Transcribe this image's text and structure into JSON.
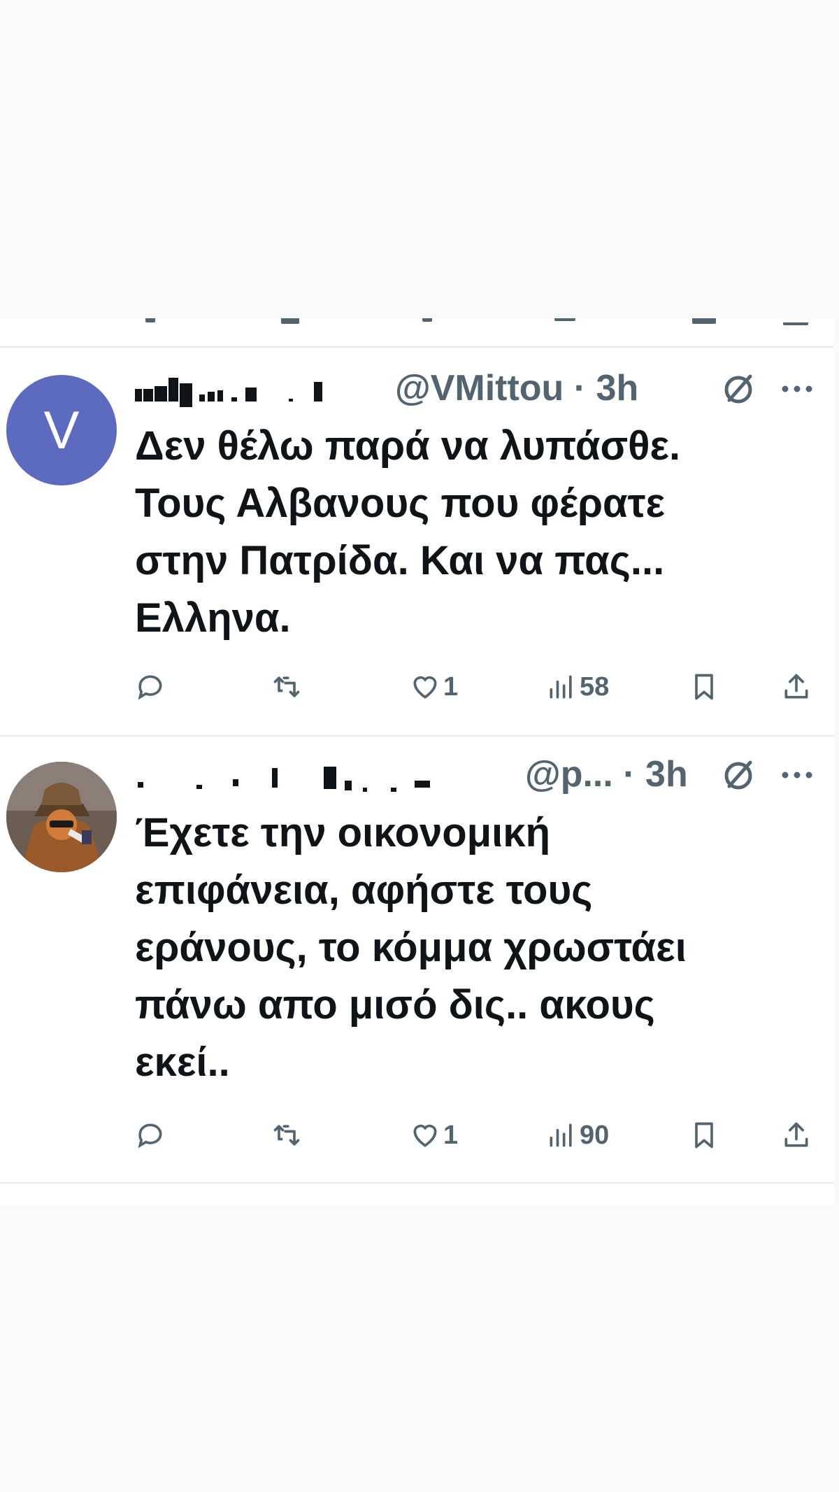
{
  "tweets": [
    {
      "avatar_letter": "V",
      "avatar_color": "#5c6bc0",
      "name": "Vicky Mittou",
      "handle_time": "@VMittou · 3h",
      "text": "Δεν θέλω παρά να λυπάσθε.\nΤους Αλβανους που φέρατε\nστην Πατρίδα. Και να πας...\nΕλληνα.",
      "reply_count": "",
      "retweet_count": "",
      "like_count": "1",
      "view_count": "58"
    },
    {
      "avatar_icon": "cartoon-fox-avatar",
      "handle_time": "@p... · 3h",
      "text": "Έχετε την οικονομική\nεπιφάνεια, αφήστε τους\nεράνους, το κόμμα χρωστάει\nπάνω απο μισό δις.. ακους\nεκεί..",
      "reply_count": "",
      "retweet_count": "",
      "like_count": "1",
      "view_count": "90"
    }
  ],
  "icons": {
    "reply": "reply-icon",
    "retweet": "retweet-icon",
    "like": "heart-icon",
    "views": "views-icon",
    "bookmark": "bookmark-icon",
    "share": "share-icon",
    "grok": "grok-icon",
    "more": "more-icon"
  },
  "colors": {
    "text": "#0f1419",
    "secondary": "#536471",
    "divider": "#e6ecf0"
  }
}
